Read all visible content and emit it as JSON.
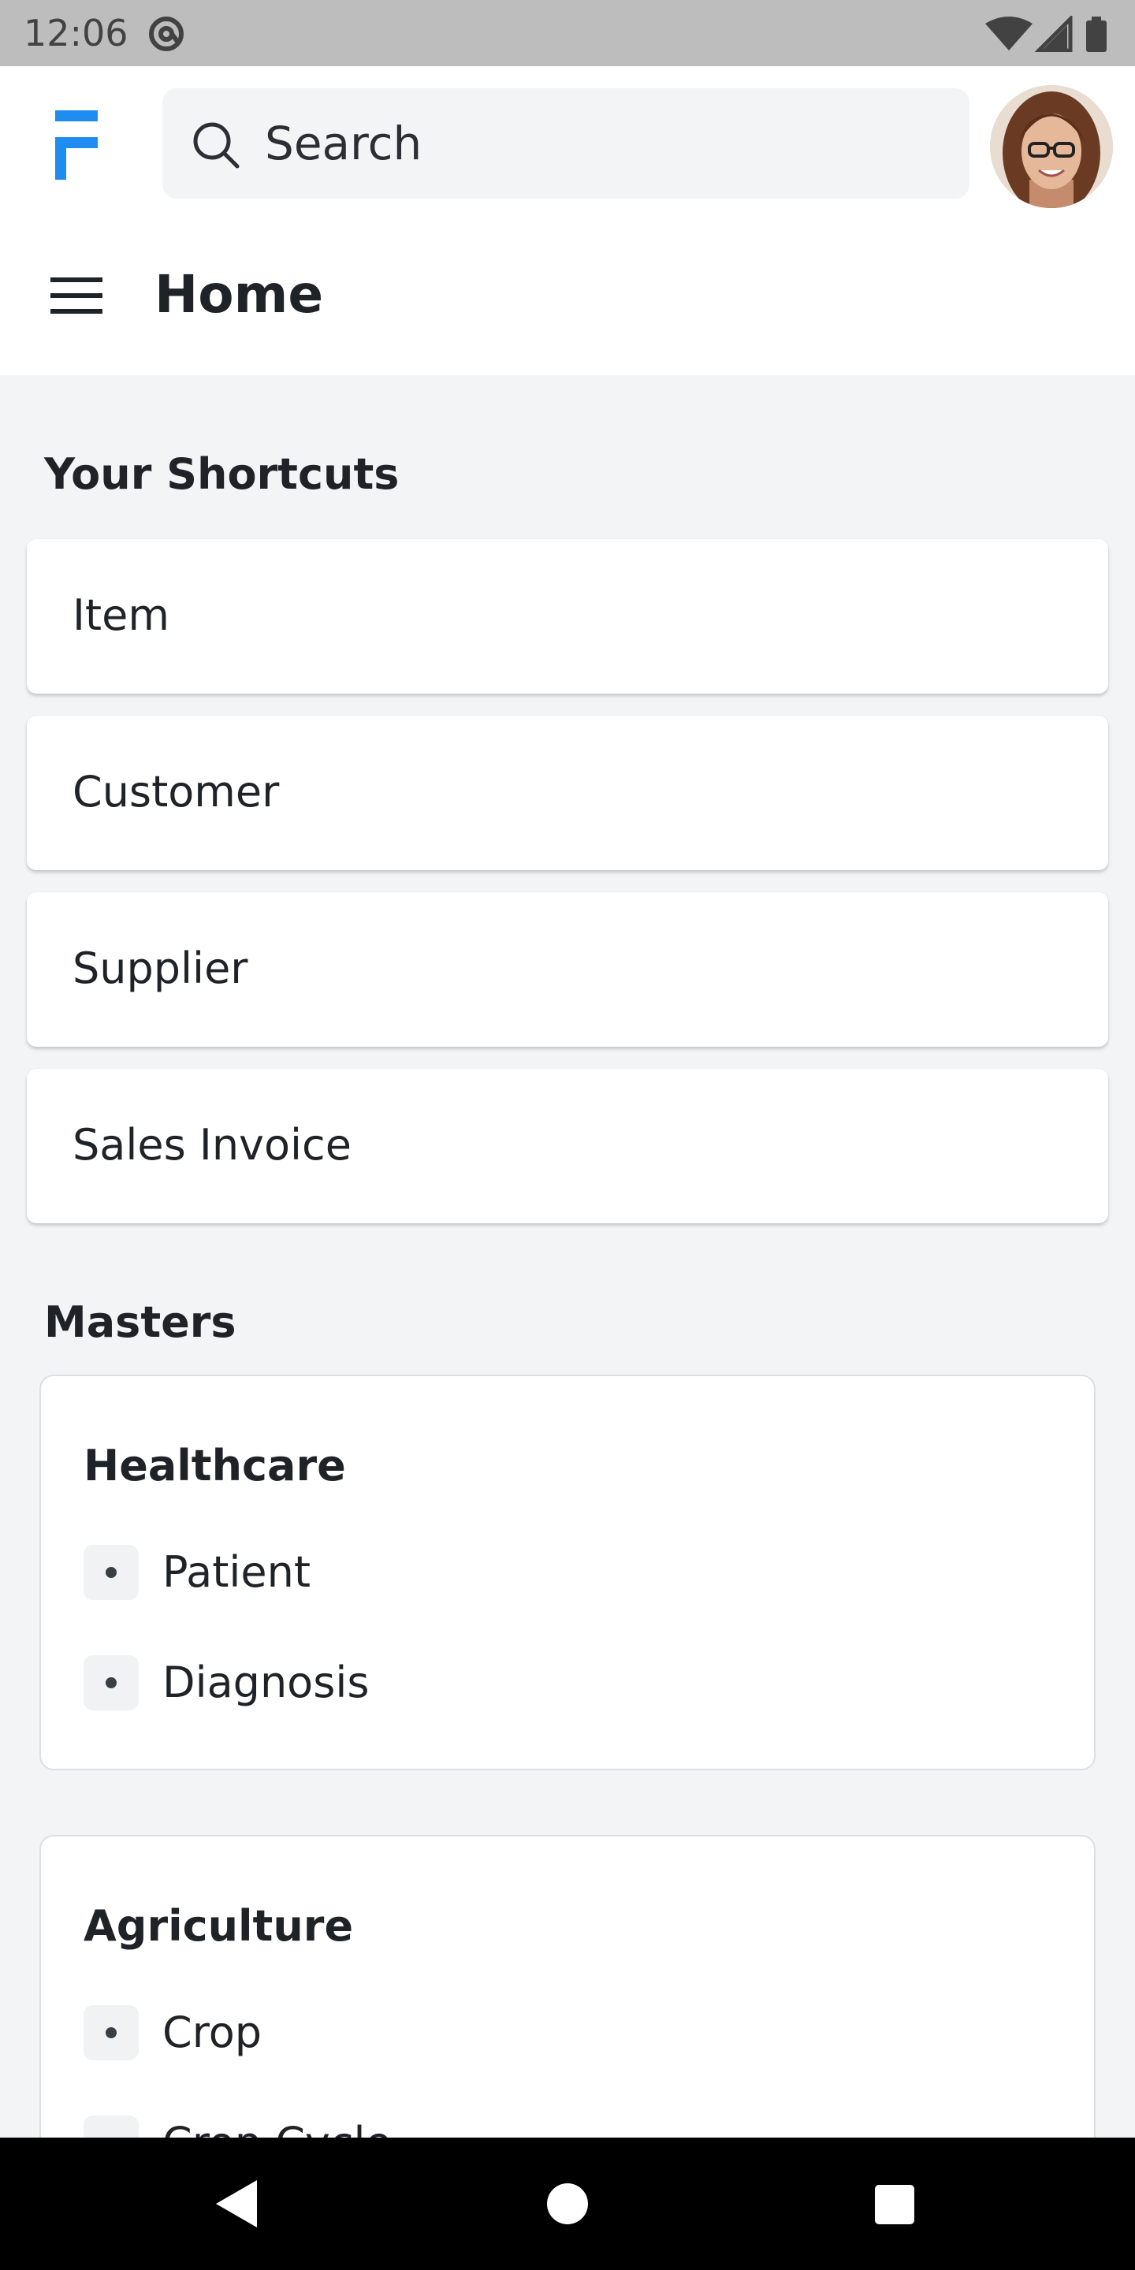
{
  "status_bar": {
    "time": "12:06",
    "icons": [
      "at-sign-icon",
      "wifi-icon",
      "cellular-signal-icon",
      "battery-icon"
    ]
  },
  "header": {
    "logo": "frappe-logo-icon",
    "search_placeholder": "Search",
    "avatar": "user-avatar",
    "menu_icon": "hamburger-menu-icon",
    "page_title": "Home"
  },
  "colors": {
    "brand": "#1f8cf0",
    "page_background": "#f3f4f6",
    "card_background": "#ffffff",
    "status_bar": "#bdbdbd",
    "nav_bar": "#000000"
  },
  "shortcuts": {
    "title": "Your Shortcuts",
    "items": [
      {
        "label": "Item"
      },
      {
        "label": "Customer"
      },
      {
        "label": "Supplier"
      },
      {
        "label": "Sales Invoice"
      }
    ]
  },
  "masters": {
    "title": "Masters",
    "cards": [
      {
        "title": "Healthcare",
        "items": [
          {
            "label": "Patient"
          },
          {
            "label": "Diagnosis"
          }
        ]
      },
      {
        "title": "Agriculture",
        "items": [
          {
            "label": "Crop"
          },
          {
            "label": "Crop Cycle"
          }
        ]
      }
    ]
  },
  "nav_bar": {
    "buttons": [
      "back-icon",
      "home-icon",
      "recents-icon"
    ]
  }
}
